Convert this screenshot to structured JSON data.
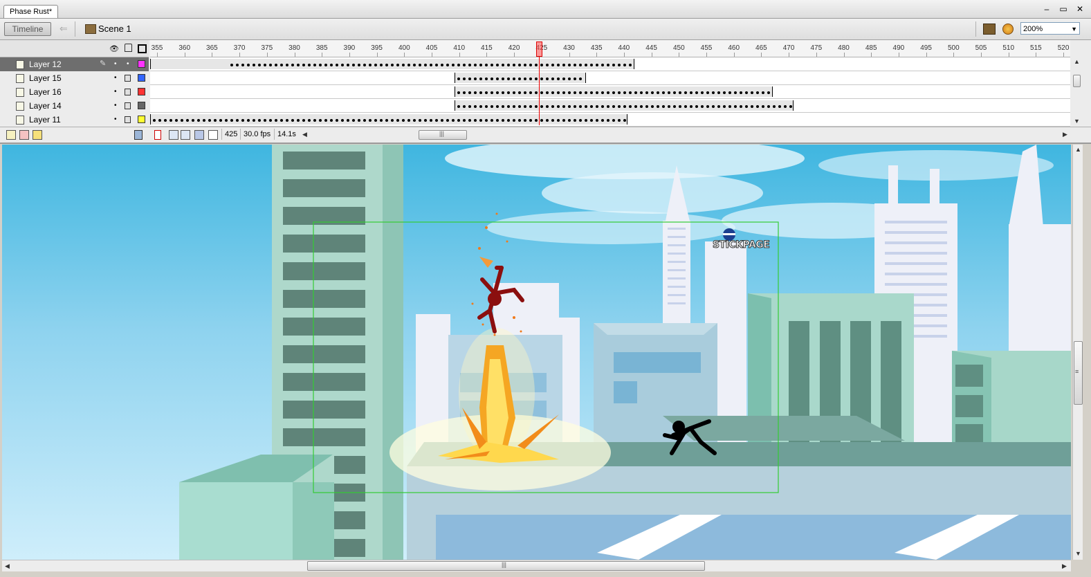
{
  "document": {
    "tab_title": "Phase Rust*"
  },
  "window_controls": {
    "minimize": "–",
    "restore": "▭",
    "close": "✕"
  },
  "edit_bar": {
    "timeline_button": "Timeline",
    "back_icon": "back-arrow-icon",
    "scene_label": "Scene 1",
    "zoom_value": "200%"
  },
  "timeline": {
    "ruler_labels": [
      "355",
      "360",
      "365",
      "370",
      "375",
      "380",
      "385",
      "390",
      "395",
      "400",
      "405",
      "410",
      "415",
      "420",
      "425",
      "430",
      "435",
      "440",
      "445",
      "450",
      "455",
      "460",
      "465",
      "470",
      "475",
      "480",
      "485",
      "490",
      "495",
      "500",
      "505",
      "510",
      "515",
      "520"
    ],
    "current_frame_marker": "425",
    "layers": [
      {
        "name": "Layer 12",
        "active": true,
        "color": "#ff33ff"
      },
      {
        "name": "Layer 15",
        "active": false,
        "color": "#3366ff"
      },
      {
        "name": "Layer 16",
        "active": false,
        "color": "#ff3333"
      },
      {
        "name": "Layer 14",
        "active": false,
        "color": "#666666"
      },
      {
        "name": "Layer 11",
        "active": false,
        "color": "#ffff33"
      }
    ],
    "status": {
      "current_frame": "425",
      "frame_rate": "30.0 fps",
      "elapsed_time": "14.1s"
    }
  },
  "stage": {
    "logo_text": "STICKPAGE"
  },
  "colors": {
    "selection_outline": "#33cc33",
    "playhead": "#e00000",
    "sky_top": "#3fb6e0"
  }
}
